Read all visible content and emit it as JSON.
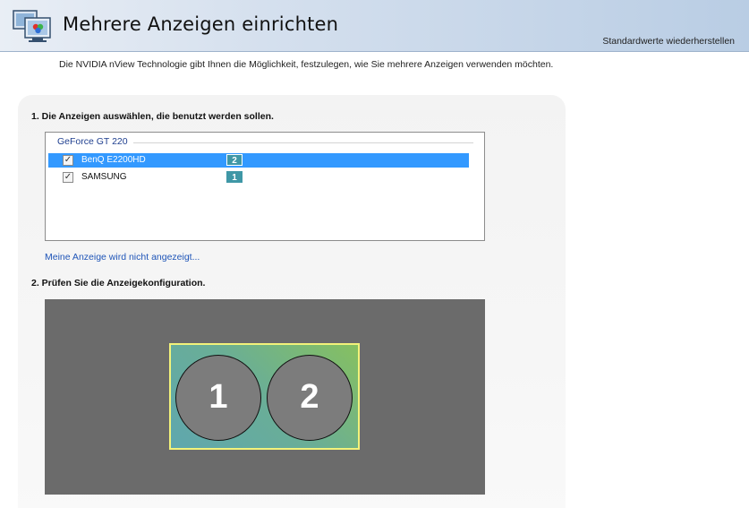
{
  "header": {
    "title": "Mehrere Anzeigen einrichten",
    "restore_defaults": "Standardwerte wiederherstellen",
    "icon": "nvidia-multi-display-icon"
  },
  "description": "Die NVIDIA nView Technologie gibt Ihnen die Möglichkeit, festzulegen, wie Sie mehrere Anzeigen verwenden möchten.",
  "step1": {
    "heading": "1. Die Anzeigen auswählen, die benutzt werden sollen.",
    "gpu": "GeForce GT 220",
    "displays": [
      {
        "name": "BenQ E2200HD",
        "number": "2",
        "checked": true,
        "selected": true
      },
      {
        "name": "SAMSUNG",
        "number": "1",
        "checked": true,
        "selected": false
      }
    ],
    "help_link": "Meine Anzeige wird nicht angezeigt..."
  },
  "step2": {
    "heading": "2. Prüfen Sie die Anzeigekonfiguration.",
    "monitors": [
      {
        "label": "1"
      },
      {
        "label": "2"
      }
    ]
  },
  "colors": {
    "selection": "#3399ff",
    "badge": "#3f97a6",
    "arrangement_bg": "#6b6b6b",
    "desktop_border": "#f2f27a",
    "link": "#1f55b8"
  }
}
